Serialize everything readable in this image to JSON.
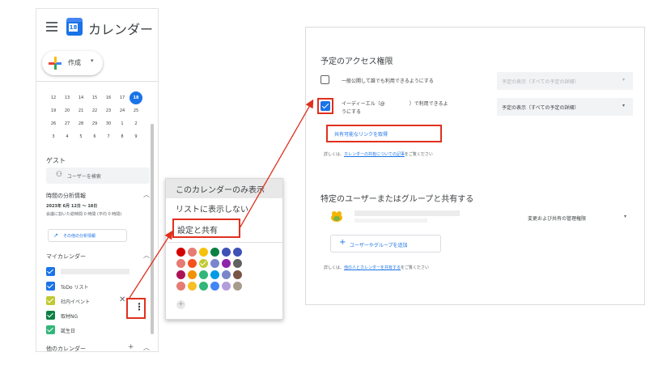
{
  "sidebar": {
    "app_title": "カレンダー",
    "logo_number": "18",
    "create_label": "作成",
    "mini_calendar": [
      [
        "12",
        "13",
        "14",
        "15",
        "16",
        "17",
        "18"
      ],
      [
        "19",
        "20",
        "21",
        "22",
        "23",
        "24",
        "25"
      ],
      [
        "26",
        "27",
        "28",
        "29",
        "30",
        "1",
        "2"
      ],
      [
        "3",
        "4",
        "5",
        "6",
        "7",
        "8",
        "9"
      ]
    ],
    "today": "18",
    "guest_label": "ゲスト",
    "user_search_placeholder": "ユーザーを検索",
    "analytics_title": "時間の分析情報",
    "analytics_date": "2023年 6月 12日 ～ 18日",
    "analytics_desc": "会議に割いた総時間 0 時間 (平均 0 時間)",
    "analytics_button": "その他の分析情報",
    "my_calendars_title": "マイカレンダー",
    "calendars": [
      {
        "label": "",
        "color": "#1a73e8"
      },
      {
        "label": "ToDo リスト",
        "color": "#1a73e8"
      },
      {
        "label": "社内イベント",
        "color": "#c0ca33"
      },
      {
        "label": "取材NG",
        "color": "#0b8043"
      },
      {
        "label": "誕生日",
        "color": "#33b679"
      }
    ],
    "other_calendars_title": "他のカレンダー"
  },
  "context_menu": {
    "items": [
      "このカレンダーのみ表示",
      "リストに表示しない",
      "設定と共有"
    ],
    "colors": [
      [
        "#d50000",
        "#e67c73",
        "#f4c20d",
        "#0b8043",
        "#3f51b5",
        "#3f51b5"
      ],
      [
        "#e67c73",
        "#f4511e",
        "#c0ca33",
        "#7986cb",
        "#8e24aa",
        "#616161"
      ],
      [
        "#ad1457",
        "#f09300",
        "#33b679",
        "#039be5",
        "#7986cb",
        "#795548"
      ],
      [
        "#e67c73",
        "#f6bf26",
        "#33b679",
        "#4285f4",
        "#b39ddb",
        "#a79b8e"
      ]
    ],
    "selected_color": "#c0ca33"
  },
  "settings": {
    "access_title": "予定のアクセス権限",
    "public_label": "一般公開して誰でも利用できるようにする",
    "public_dropdown": "予定の表示（すべての予定の詳細）",
    "org_label_1": "イーディーエル（@",
    "org_label_1_end": "）で利用できるよ",
    "org_label_2": "うにする",
    "org_dropdown": "予定の表示（すべての予定の詳細）",
    "share_link": "共有可能なリンクを取得",
    "info1_prefix": "詳しくは、",
    "info1_link": "カレンダーの共有についての記事",
    "info1_suffix": "をご覧ください",
    "share_title": "特定のユーザーまたはグループと共有する",
    "user_permission": "変更および共有の管理権限",
    "add_button": "ユーザーやグループを追加",
    "info2_prefix": "詳しくは、",
    "info2_link": "他の人とカレンダーを共有する",
    "info2_suffix": "をご覧ください"
  },
  "icons": {
    "caret": "▾",
    "chevron_up": "︿",
    "close": "✕",
    "more": "⋮",
    "plus": "+"
  },
  "accent_color": "#e0301e"
}
